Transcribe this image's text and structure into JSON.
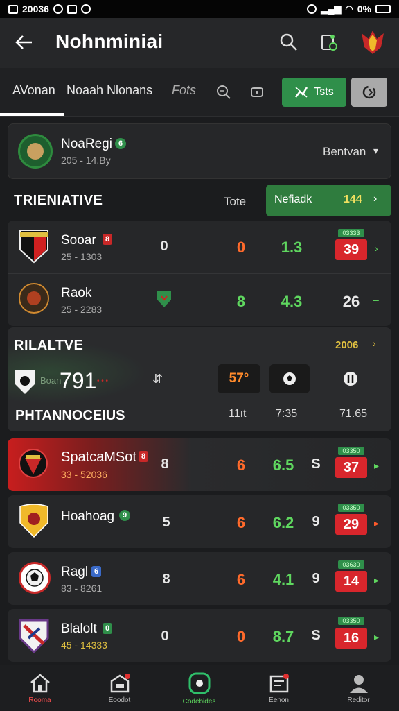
{
  "status_bar": {
    "time": "20036",
    "battery": "0%"
  },
  "app_bar": {
    "title": "Nohnminiai"
  },
  "tabs": [
    {
      "label": "AVonan"
    },
    {
      "label": "Noaah Nlonans"
    },
    {
      "label": "Fots"
    }
  ],
  "tab_button": {
    "label": "Tsts"
  },
  "competition": {
    "name": "NoaRegi",
    "badge": "6",
    "meta": "205 - 14.By",
    "selector": "Bentvan"
  },
  "section1": {
    "title": "TRIENIATIVE",
    "col_label": "Tote",
    "highlight_label": "Nefiadk",
    "highlight_value": "144"
  },
  "section1_rows": [
    {
      "team": "Sooar",
      "badge": "8",
      "meta": "25 - 1303",
      "col1": "0",
      "col2": "0",
      "col3": "1.3",
      "tag": "03333",
      "score": "39"
    },
    {
      "team": "Raok",
      "badge": "",
      "meta": "25 - 2283",
      "col1": "",
      "col2": "8",
      "col3": "4.3",
      "score": "26"
    }
  ],
  "section2": {
    "title": "RILALTVE",
    "tag": "2006",
    "big_value": "791",
    "prefix": "Boan",
    "chip1": "57°",
    "subtitle": "PHTANNOCEIUS",
    "stat1": "11ıt",
    "stat2": "7:35",
    "stat3": "71.65"
  },
  "matches": [
    {
      "team": "SpatcaMSot",
      "badge": "8",
      "meta": "33 - 52036",
      "col1": "8",
      "col2": "6",
      "col3": "6.5",
      "col4": "S",
      "tag": "03350",
      "score": "37",
      "arrow_color": "#5fd75f"
    },
    {
      "team": "Hoahoag",
      "badge": "9",
      "meta": "",
      "col1": "5",
      "col2": "6",
      "col3": "6.2",
      "col4": "9",
      "tag": "03350",
      "score": "29",
      "arrow_color": "#ff5a2b"
    },
    {
      "team": "Ragl",
      "badge": "6",
      "meta": "83 - 8261",
      "col1": "8",
      "col2": "6",
      "col3": "4.1",
      "col4": "9",
      "tag": "03630",
      "score": "14",
      "arrow_color": "#5fd75f"
    },
    {
      "team": "Blalolt",
      "badge": "0",
      "meta": "45 - 14333",
      "col1": "0",
      "col2": "0",
      "col3": "8.7",
      "col4": "S",
      "tag": "03350",
      "score": "16",
      "arrow_color": "#5fd75f"
    }
  ],
  "bottom_nav": [
    {
      "label": "Rooma",
      "icon": "home-icon"
    },
    {
      "label": "Eoodot",
      "icon": "store-icon"
    },
    {
      "label": "Codebides",
      "icon": "target-icon"
    },
    {
      "label": "Eenon",
      "icon": "calendar-icon"
    },
    {
      "label": "Reditor",
      "icon": "person-icon"
    }
  ]
}
